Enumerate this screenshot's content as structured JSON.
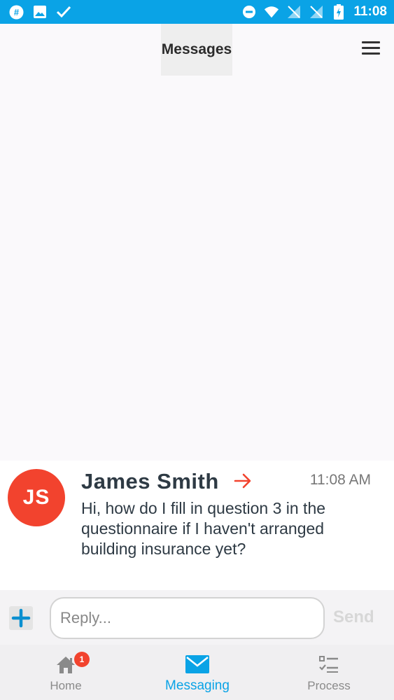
{
  "status_bar": {
    "time": "11:08",
    "left_icons": [
      "slack-icon",
      "image-icon",
      "check-icon"
    ],
    "right_icons": [
      "do-not-disturb-icon",
      "wifi-icon",
      "no-signal-icon",
      "no-signal-icon",
      "battery-charging-icon"
    ]
  },
  "header": {
    "title": "Messages"
  },
  "message": {
    "avatar_initials": "JS",
    "sender": "James Smith",
    "time": "11:08 AM",
    "body": "Hi, how do I fill in question 3 in the questionnaire if I haven't arranged building insurance yet?"
  },
  "reply": {
    "placeholder": "Reply...",
    "send_label": "Send"
  },
  "nav": {
    "items": [
      {
        "label": "Home",
        "badge": "1"
      },
      {
        "label": "Messaging"
      },
      {
        "label": "Process"
      }
    ]
  },
  "colors": {
    "accent": "#0aa3e6",
    "avatar": "#f2432e",
    "arrow": "#f2432e"
  }
}
